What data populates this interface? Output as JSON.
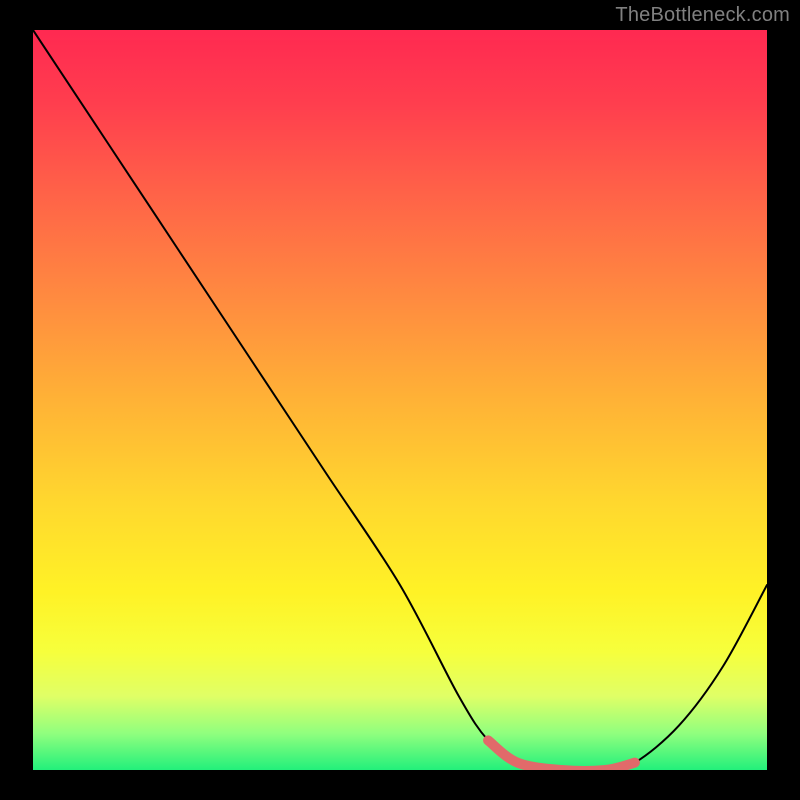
{
  "attribution": "TheBottleneck.com",
  "chart_data": {
    "type": "line",
    "title": "",
    "xlabel": "",
    "ylabel": "",
    "xlim": [
      0,
      100
    ],
    "ylim": [
      0,
      100
    ],
    "series": [
      {
        "name": "bottleneck-curve",
        "x": [
          0,
          4,
          10,
          20,
          30,
          40,
          50,
          58,
          62,
          66,
          72,
          78,
          82,
          88,
          94,
          100
        ],
        "y": [
          100,
          94,
          85,
          70,
          55,
          40,
          25,
          10,
          4,
          1,
          0,
          0,
          1,
          6,
          14,
          25
        ]
      }
    ],
    "highlight": {
      "name": "optimal-band",
      "color": "#e16a6a",
      "x": [
        62,
        66,
        72,
        78,
        82
      ],
      "y": [
        4,
        1,
        0,
        0,
        1
      ]
    },
    "background_gradient": {
      "top": "#ff2951",
      "mid": "#ffd82e",
      "bottom": "#22f07b"
    }
  }
}
